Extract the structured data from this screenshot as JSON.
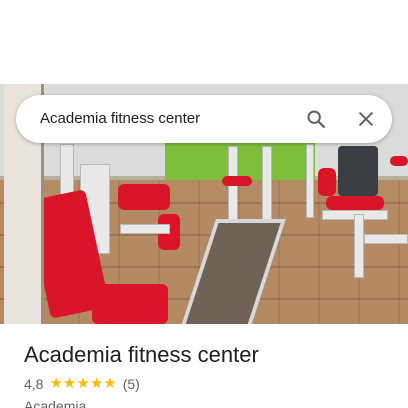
{
  "search": {
    "query": "Academia fitness center"
  },
  "place": {
    "name": "Academia fitness center",
    "rating": "4,8",
    "rating_fraction": 0.96,
    "stars_filled": 5,
    "review_count": "(5)",
    "category": "Academia"
  },
  "colors": {
    "star": "#fbbc04",
    "title_text": "#202124",
    "secondary_text": "#5f6368",
    "icon": "#5f6368"
  },
  "icons": {
    "search": "search-icon",
    "close": "close-icon",
    "star": "star-icon"
  }
}
